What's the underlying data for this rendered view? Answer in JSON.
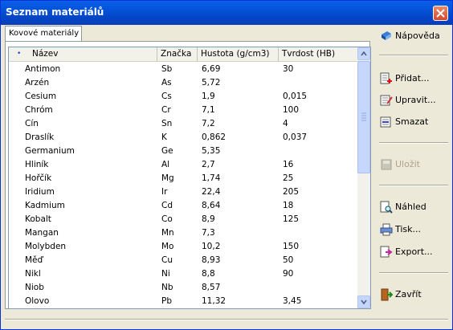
{
  "window": {
    "title": "Seznam materiálů"
  },
  "tab": {
    "label": "Kovové materiály"
  },
  "table": {
    "sort_marker": "•",
    "columns": [
      "Název",
      "Značka",
      "Hustota (g/cm3)",
      "Tvrdost (HB)"
    ],
    "rows": [
      [
        "Antimon",
        "Sb",
        "6,69",
        "30"
      ],
      [
        "Arzén",
        "As",
        "5,72",
        ""
      ],
      [
        "Cesium",
        "Cs",
        "1,9",
        "0,015"
      ],
      [
        "Chróm",
        "Cr",
        "7,1",
        "100"
      ],
      [
        "Cín",
        "Sn",
        "7,2",
        "4"
      ],
      [
        "Draslík",
        "K",
        "0,862",
        "0,037"
      ],
      [
        "Germanium",
        "Ge",
        "5,35",
        ""
      ],
      [
        "Hliník",
        "Al",
        "2,7",
        "16"
      ],
      [
        "Hořčík",
        "Mg",
        "1,74",
        "25"
      ],
      [
        "Iridium",
        "Ir",
        "22,4",
        "205"
      ],
      [
        "Kadmium",
        "Cd",
        "8,64",
        "18"
      ],
      [
        "Kobalt",
        "Co",
        "8,9",
        "125"
      ],
      [
        "Mangan",
        "Mn",
        "7,3",
        ""
      ],
      [
        "Molybden",
        "Mo",
        "10,2",
        "150"
      ],
      [
        "Měď",
        "Cu",
        "8,93",
        "50"
      ],
      [
        "Nikl",
        "Ni",
        "8,8",
        "90"
      ],
      [
        "Niob",
        "Nb",
        "8,57",
        ""
      ],
      [
        "Olovo",
        "Pb",
        "11,32",
        "3,45"
      ]
    ]
  },
  "buttons": {
    "help": "Nápověda",
    "add": "Přidat...",
    "edit": "Upravit...",
    "delete": "Smazat",
    "save": "Uložit",
    "preview": "Náhled",
    "print": "Tisk...",
    "export": "Export...",
    "close": "Zavřít"
  }
}
